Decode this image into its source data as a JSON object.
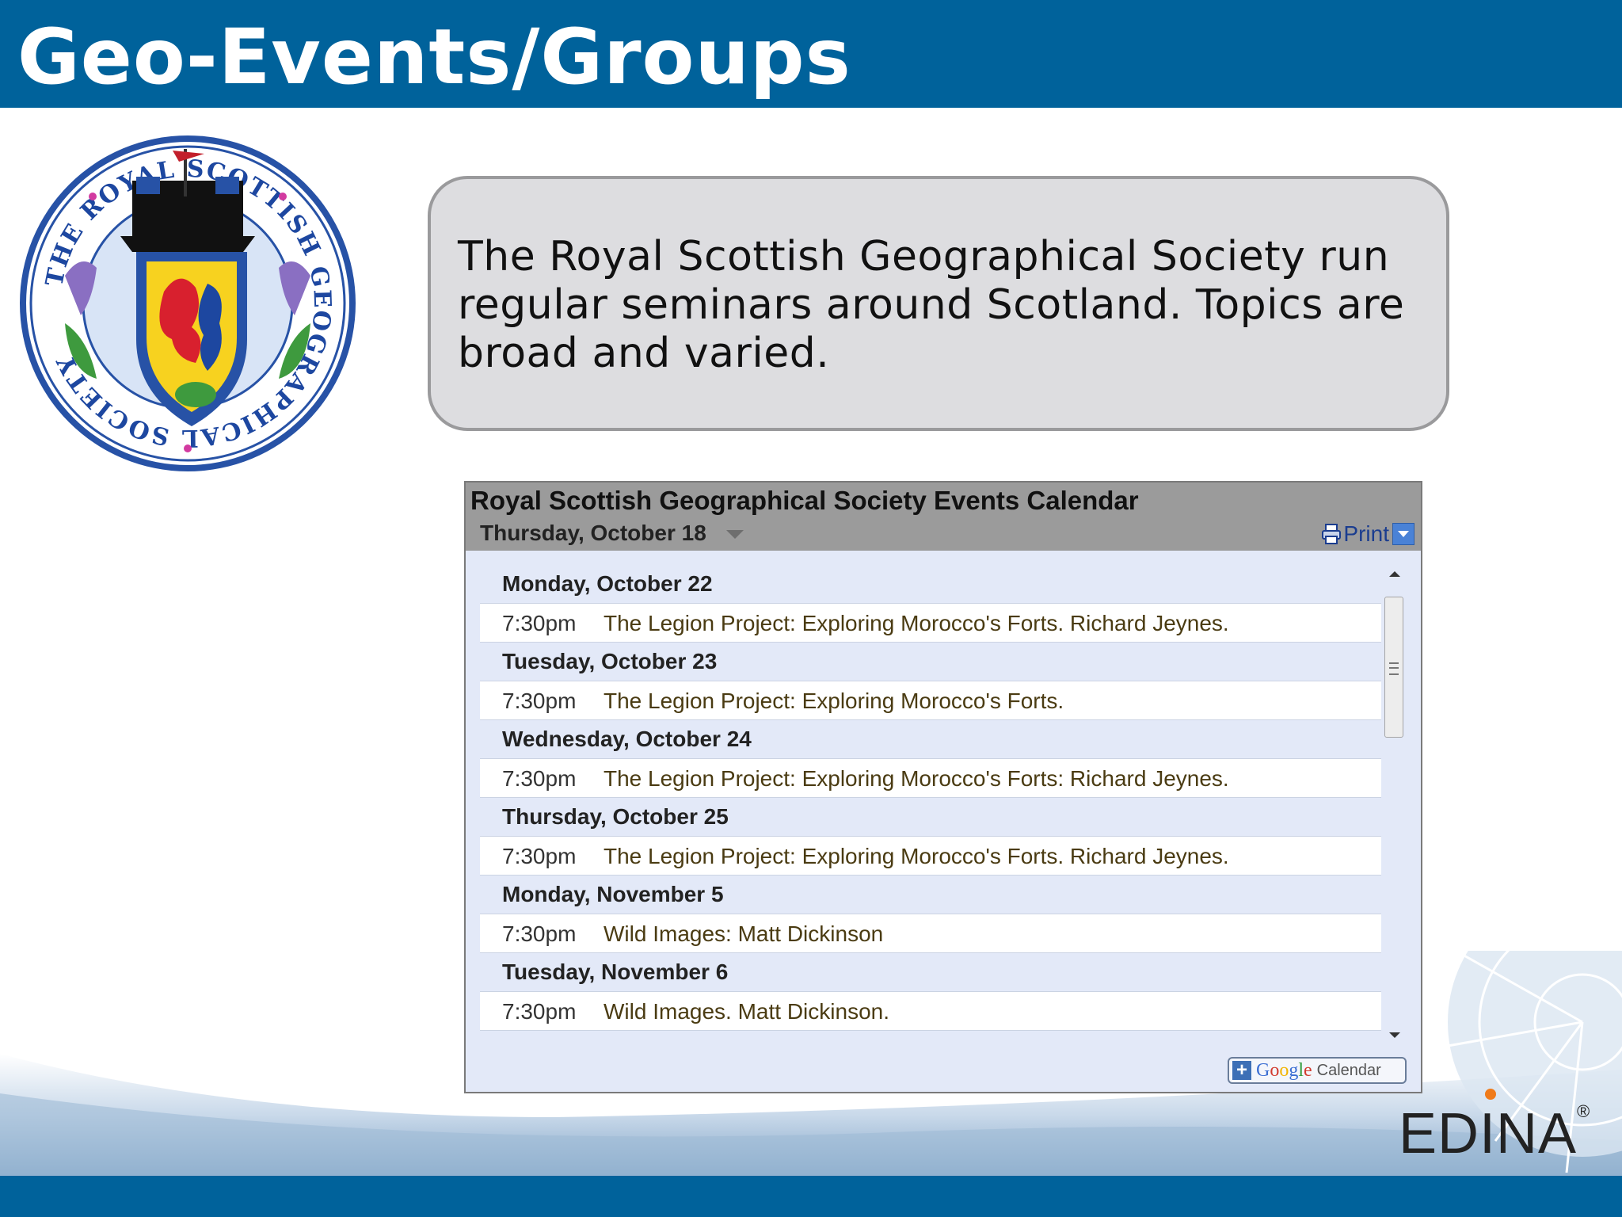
{
  "slide": {
    "title": "Geo-Events/Groups",
    "callout_text": "The Royal Scottish Geographical Society run regular seminars around Scotland. Topics are broad and varied.",
    "seal_text": "THE ROYAL SCOTTISH GEOGRAPHICAL SOCIETY",
    "brand_logo_text": "EDINA",
    "brand_logo_mark": "®"
  },
  "calendar": {
    "title": "Royal Scottish Geographical Society Events Calendar",
    "current_date": "Thursday, October 18",
    "print_label": "Print",
    "google_button": {
      "google": "Google",
      "calendar": "Calendar"
    },
    "days": [
      {
        "date": "Monday, October 22",
        "events": [
          {
            "time": "7:30pm",
            "title": "The Legion Project: Exploring Morocco's Forts. Richard Jeynes."
          }
        ]
      },
      {
        "date": "Tuesday, October 23",
        "events": [
          {
            "time": "7:30pm",
            "title": "The Legion Project: Exploring Morocco's Forts."
          }
        ]
      },
      {
        "date": "Wednesday, October 24",
        "events": [
          {
            "time": "7:30pm",
            "title": "The Legion Project: Exploring Morocco's Forts: Richard Jeynes."
          }
        ]
      },
      {
        "date": "Thursday, October 25",
        "events": [
          {
            "time": "7:30pm",
            "title": "The Legion Project: Exploring Morocco's Forts. Richard Jeynes."
          }
        ]
      },
      {
        "date": "Monday, November 5",
        "events": [
          {
            "time": "7:30pm",
            "title": "Wild Images: Matt Dickinson"
          }
        ]
      },
      {
        "date": "Tuesday, November 6",
        "events": [
          {
            "time": "7:30pm",
            "title": "Wild Images. Matt Dickinson."
          }
        ]
      }
    ]
  },
  "colors": {
    "brand_blue": "#00629b",
    "callout_bg": "#dddde0",
    "widget_bg": "#e3e9f8",
    "accent_orange": "#f07b1a"
  },
  "icons": [
    "seal-logo",
    "printer-icon",
    "dropdown-icon",
    "scroll-up-icon",
    "scroll-down-icon",
    "plus-icon"
  ]
}
